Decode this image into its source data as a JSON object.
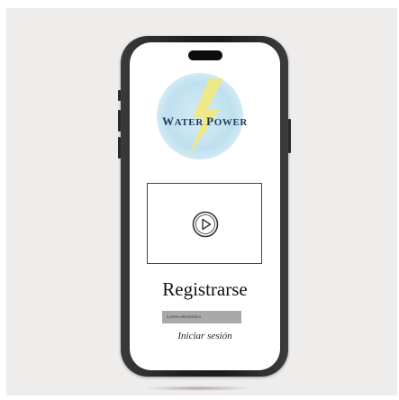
{
  "logo": {
    "word1_initial": "W",
    "word1_rest": "ATER",
    "word2_initial": "P",
    "word2_rest": "OWER",
    "icon": "lightning-bolt-icon",
    "colors": {
      "circle": "#bfe0ef",
      "bolt": "#f3e87a",
      "text": "#1e3a5c"
    }
  },
  "video": {
    "icon": "play-circle-icon"
  },
  "register": {
    "title": "Registrarse",
    "email_placeholder": "Correo electrónico",
    "login_link": "Iniciar sesión"
  },
  "colors": {
    "background": "#efedec",
    "phone_frame": "#1e1e20",
    "screen": "#ffffff",
    "email_field": "#a9a9a9"
  }
}
